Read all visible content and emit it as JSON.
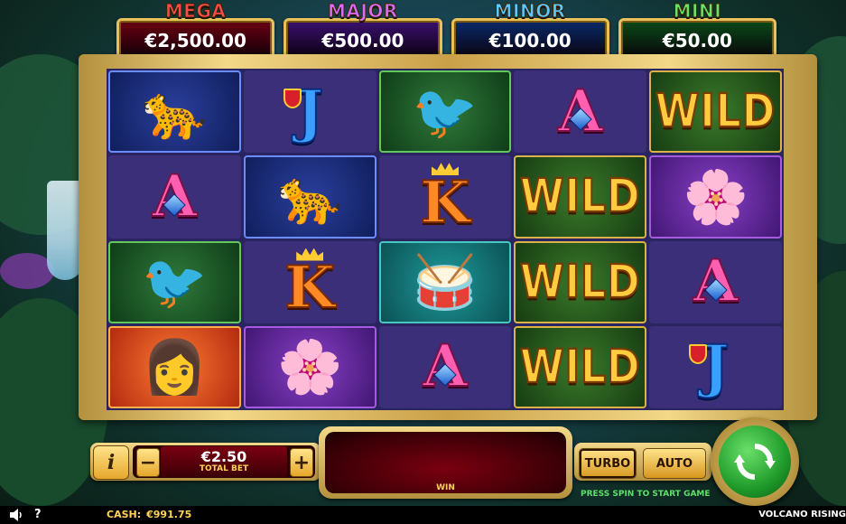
{
  "jackpots": [
    {
      "name": "MEGA",
      "value": "€2,500.00",
      "name_color": "#ff4a4a",
      "box_color": "#6a0010"
    },
    {
      "name": "MAJOR",
      "value": "€500.00",
      "name_color": "#d86bff",
      "box_color": "#3a1070"
    },
    {
      "name": "MINOR",
      "value": "€100.00",
      "name_color": "#5ac8ff",
      "box_color": "#0a2a6a"
    },
    {
      "name": "MINI",
      "value": "€50.00",
      "name_color": "#6be06a",
      "box_color": "#0a4a1a"
    }
  ],
  "reels": [
    [
      "jaguar",
      "A",
      "toucan",
      "woman"
    ],
    [
      "J",
      "jaguar",
      "K",
      "orchid"
    ],
    [
      "toucan",
      "K",
      "drum",
      "A"
    ],
    [
      "A",
      "WILD",
      "WILD",
      "WILD"
    ],
    [
      "WILD",
      "orchid",
      "A",
      "J"
    ]
  ],
  "controls": {
    "info_label": "i",
    "minus_label": "−",
    "plus_label": "+",
    "bet_value": "€2.50",
    "bet_label": "TOTAL BET",
    "win_label": "WIN",
    "turbo_label": "TURBO",
    "auto_label": "AUTO",
    "press_text": "PRESS SPIN TO START GAME"
  },
  "status": {
    "help_label": "?",
    "cash_label": "CASH:",
    "cash_value": "€991.75",
    "game_name": "VOLCANO RISING"
  },
  "icons": {
    "sound": "speaker-icon",
    "spin": "spin-arrows-icon"
  }
}
